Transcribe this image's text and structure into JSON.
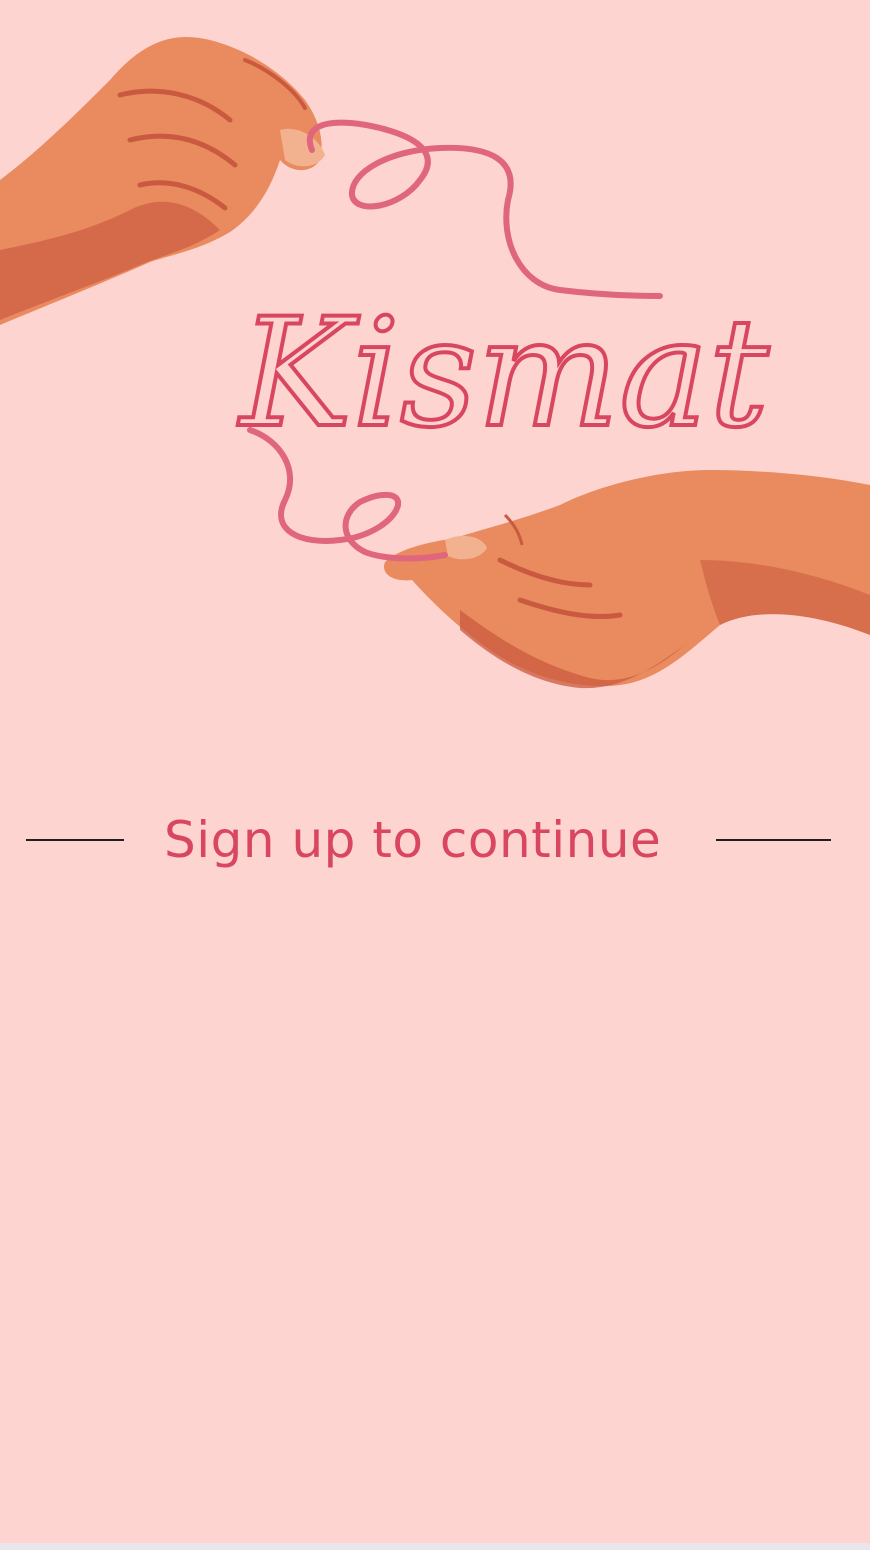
{
  "app": {
    "logo_text": "Kismat"
  },
  "signup": {
    "label": "Sign up to continue"
  },
  "colors": {
    "background": "#fdd4d0",
    "accent": "#d9465f",
    "thread": "#e0667e",
    "skin": "#e98b5e",
    "skin_shadow": "#c9593f",
    "divider": "#1f1f1f"
  }
}
